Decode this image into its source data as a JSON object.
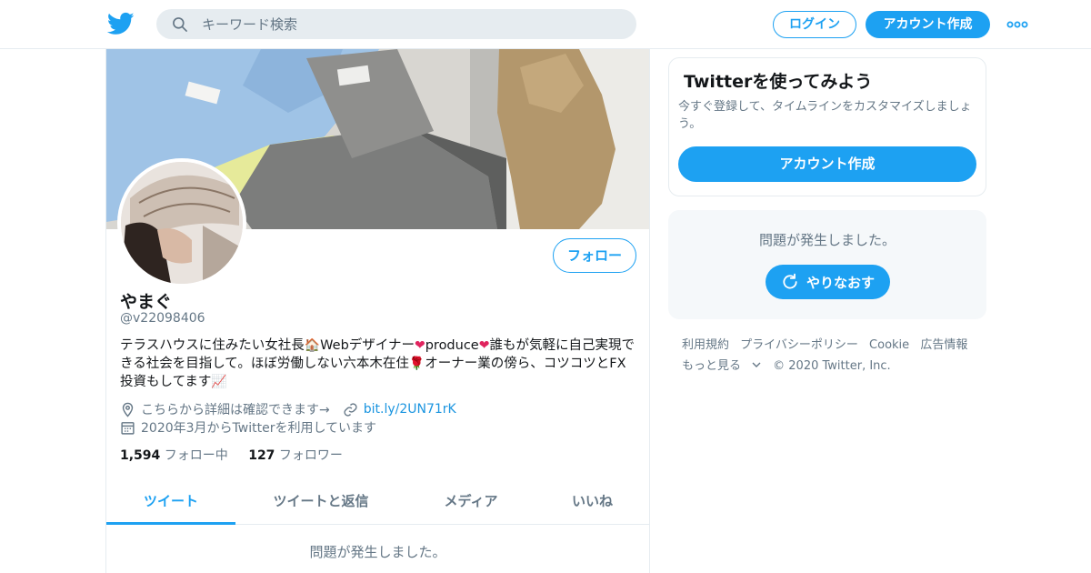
{
  "colors": {
    "accent": "#1da1f2",
    "link": "#1b95e0",
    "muted": "#657786",
    "border": "#e6ecf0",
    "panel": "#f5f8fa"
  },
  "header": {
    "logo_icon": "twitter-bird-icon",
    "search_placeholder": "キーワード検索",
    "login_label": "ログイン",
    "signup_label": "アカウント作成",
    "more_icon": "more-dots-icon"
  },
  "profile": {
    "follow_label": "フォロー",
    "display_name": "やまぐ",
    "handle": "@v22098406",
    "bio_parts": [
      "テラスハウスに住みたい女社長",
      "Webデザイナー",
      "produce",
      "誰もが気軽に自己実現できる社会を目指して。ほぼ労働しない六本木在住",
      "オーナー業の傍ら、コツコツとFX投資もしてます"
    ],
    "bio_emojis": [
      "🏠",
      "❤",
      "❤",
      "🌹",
      "📈"
    ],
    "location": "こちらから詳細は確認できます→",
    "url": "bit.ly/2UN71rK",
    "joined": "2020年3月からTwitterを利用しています",
    "following_count": "1,594",
    "following_label": "フォロー中",
    "followers_count": "127",
    "followers_label": "フォロワー",
    "tabs": [
      {
        "label": "ツイート",
        "active": true
      },
      {
        "label": "ツイートと返信",
        "active": false
      },
      {
        "label": "メディア",
        "active": false
      },
      {
        "label": "いいね",
        "active": false
      }
    ],
    "timeline_error": "問題が発生しました。"
  },
  "sidebar": {
    "signup_card": {
      "title": "Twitterを使ってみよう",
      "description": "今すぐ登録して、タイムラインをカスタマイズしましょう。",
      "button": "アカウント作成"
    },
    "error_card": {
      "message": "問題が発生しました。",
      "retry_label": "やりなおす",
      "retry_icon": "refresh-icon"
    },
    "footer": {
      "terms": "利用規約",
      "privacy": "プライバシーポリシー",
      "cookie": "Cookie",
      "ads": "広告情報",
      "more": "もっと見る",
      "copyright": "© 2020 Twitter, Inc."
    }
  }
}
